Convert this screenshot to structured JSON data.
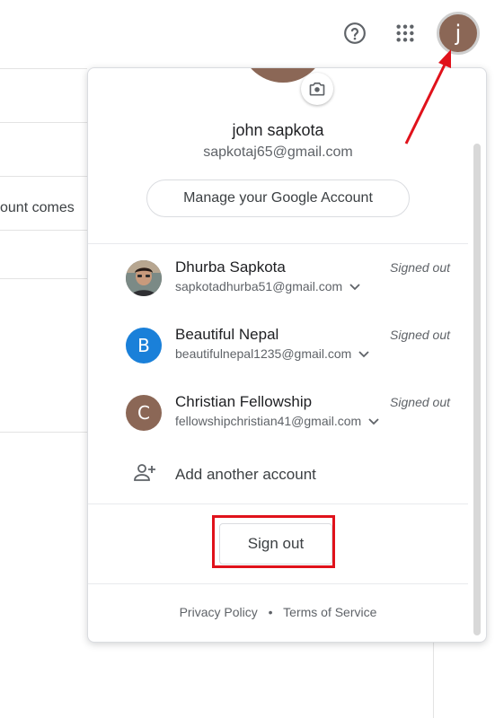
{
  "background": {
    "partial_text": "ount comes"
  },
  "topbar": {
    "help_icon": "help-circle-icon",
    "apps_icon": "apps-grid-icon",
    "avatar_letter": "j"
  },
  "popup": {
    "user_name": "john sapkota",
    "user_email": "sapkotaj65@gmail.com",
    "manage_label": "Manage your Google Account",
    "camera_icon": "camera-icon",
    "accounts": [
      {
        "name": "Dhurba Sapkota",
        "email": "sapkotadhurba51@gmail.com",
        "status": "Signed out",
        "avatar": "photo",
        "avatar_color": "#5a4a40"
      },
      {
        "name": "Beautiful Nepal",
        "email": "beautifulnepal1235@gmail.com",
        "status": "Signed out",
        "avatar": "B",
        "avatar_color": "#1a80d9"
      },
      {
        "name": "Christian Fellowship",
        "email": "fellowshipchristian41@gmail.com",
        "status": "Signed out",
        "avatar": "C",
        "avatar_color": "#8b6756"
      }
    ],
    "add_account_label": "Add another account",
    "sign_out_label": "Sign out",
    "footer": {
      "privacy": "Privacy Policy",
      "separator": "•",
      "terms": "Terms of Service"
    }
  },
  "colors": {
    "highlight": "#e0121b",
    "accent_avatar": "#8b6756"
  }
}
